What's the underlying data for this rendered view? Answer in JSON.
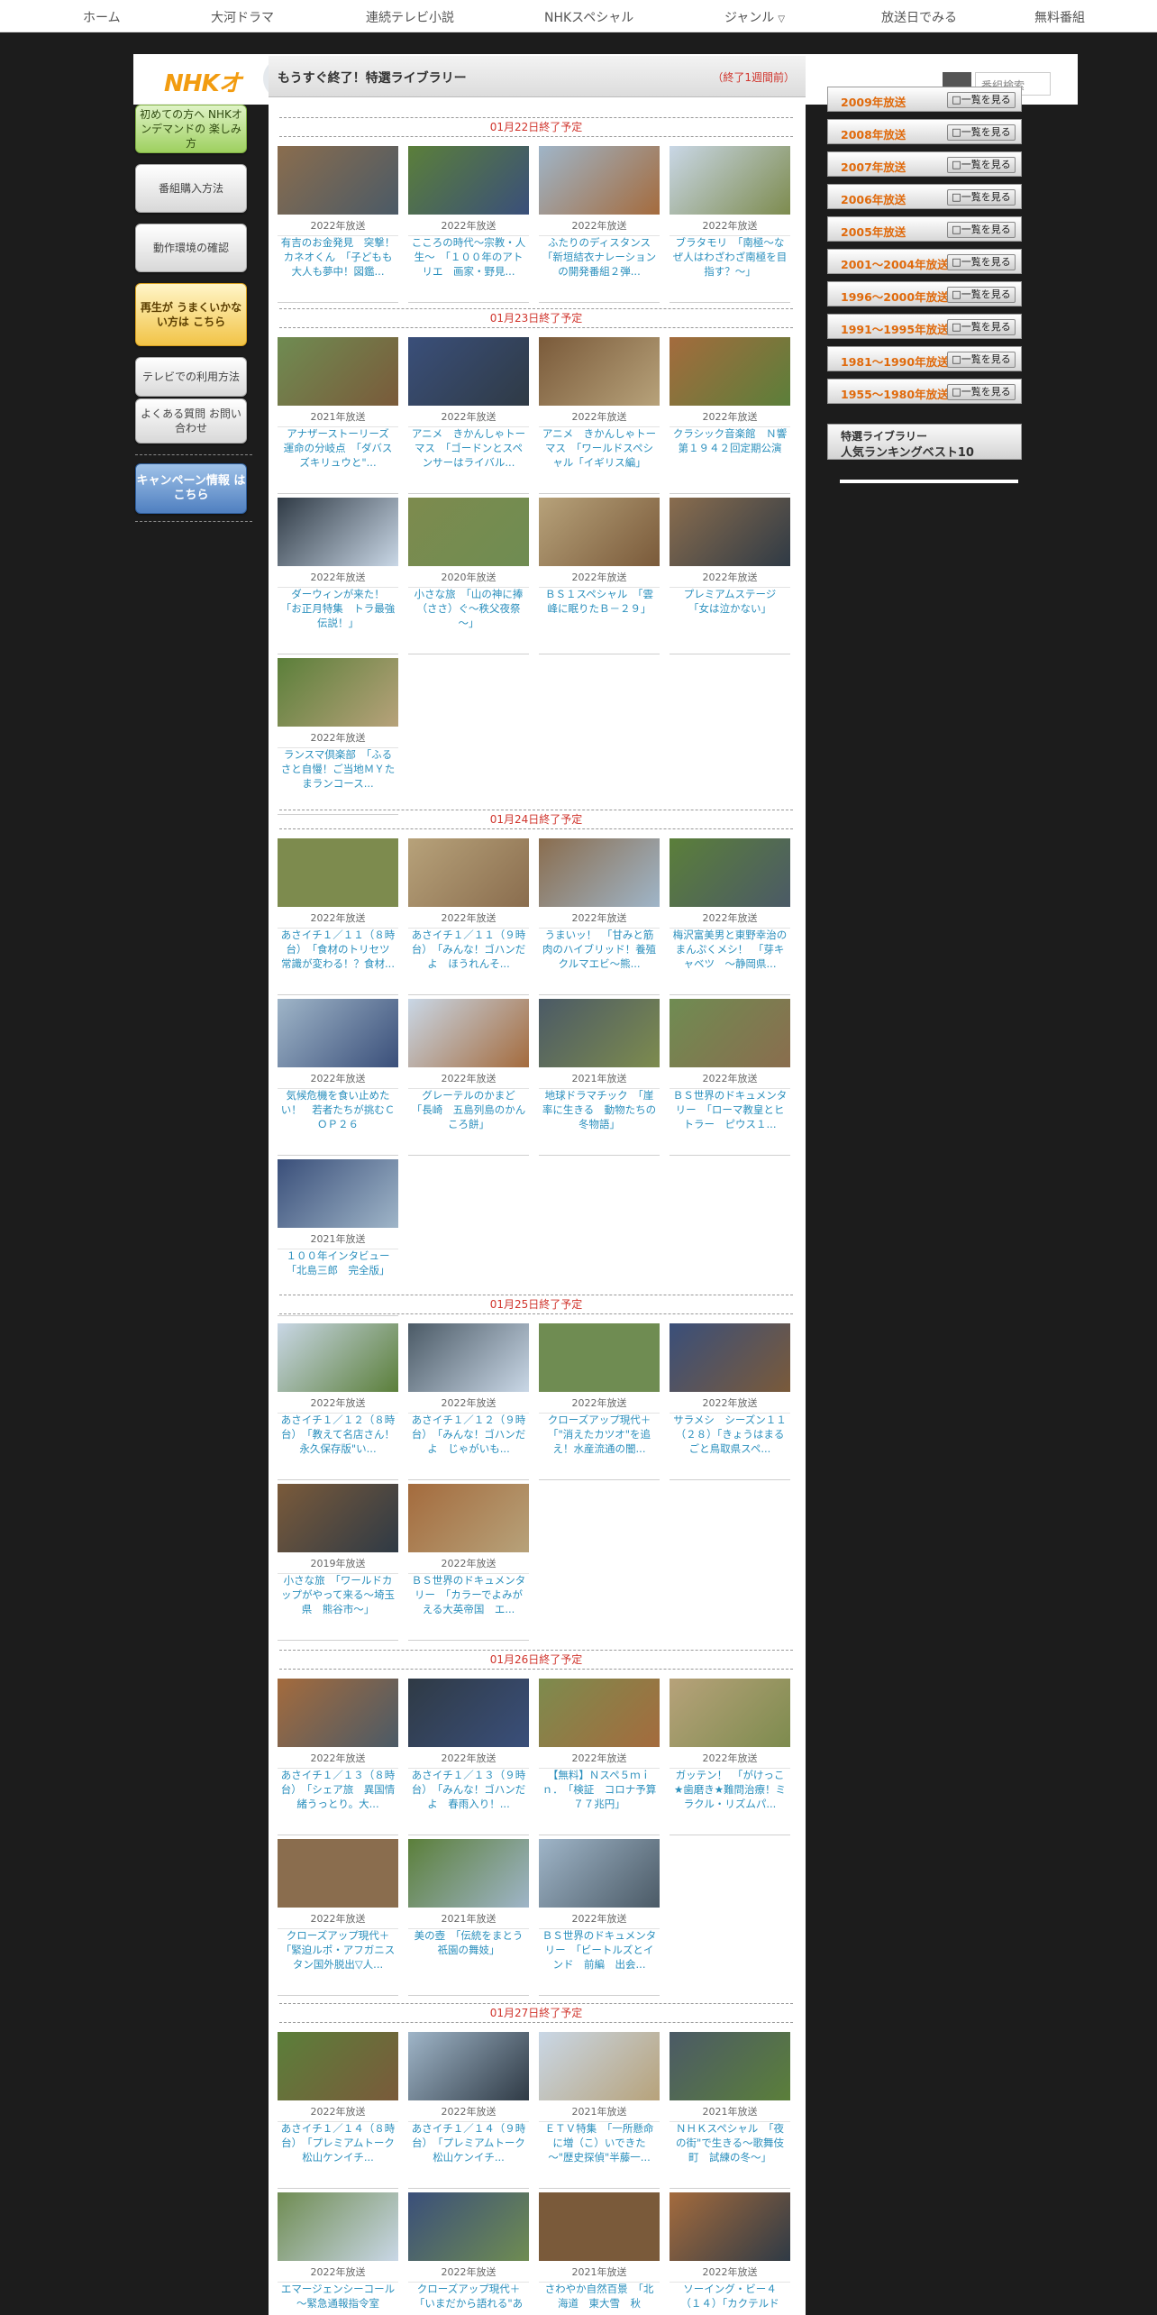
{
  "nav": [
    "ホーム",
    "大河ドラマ",
    "連続テレビ小説",
    "NHKスペシャル",
    "ジャンル",
    "放送日でみる",
    "無料番組"
  ],
  "header": {
    "logo": "NHKオ",
    "search_placeholder": "番組検索"
  },
  "main": {
    "title": "もうすぐ終了！特選ライブラリー",
    "note": "（終了1週間前）"
  },
  "left_sidebar": [
    "初めての方へ NHKオンデマンドの 楽しみ方",
    "番組購入方法",
    "動作環境の確認",
    "再生が うまくいかない方は こちら",
    "テレビでの利用方法",
    "よくある質問 お問い合わせ",
    "キャンペーン情報 はこちら"
  ],
  "sections": [
    {
      "date": "01月22日終了予定",
      "cards": [
        {
          "year": "2022年放送",
          "title": "有吉のお金発見　突撃！カネオくん　「子どもも大人も夢中！図鑑..."
        },
        {
          "year": "2022年放送",
          "title": "こころの時代～宗教・人生～　「１００年のアトリエ　画家・野見..."
        },
        {
          "year": "2022年放送",
          "title": "ふたりのディスタンス　「新垣結衣ナレーションの開発番組２弾..."
        },
        {
          "year": "2022年放送",
          "title": "ブラタモリ　「南極～なぜ人はわざわざ南極を目指す？～」"
        }
      ]
    },
    {
      "date": "01月23日終了予定",
      "cards": [
        {
          "year": "2021年放送",
          "title": "アナザーストーリーズ　運命の分岐点　「ダバスズキリュウと\"..."
        },
        {
          "year": "2022年放送",
          "title": "アニメ　きかんしゃトーマス　「ゴードンとスペンサーはライバル..."
        },
        {
          "year": "2022年放送",
          "title": "アニメ　きかんしゃトーマス　「ワールドスペシャル「イギリス編」"
        },
        {
          "year": "2022年放送",
          "title": "クラシック音楽館　Ｎ響第１９４２回定期公演"
        },
        {
          "year": "2022年放送",
          "title": "ダーウィンが来た！　「お正月特集　トラ最強伝説！」"
        },
        {
          "year": "2020年放送",
          "title": "小さな旅　「山の神に捧（ささ）ぐ～秩父夜祭～」"
        },
        {
          "year": "2022年放送",
          "title": "ＢＳ１スペシャル　「雲峰に眠りたＢ－２９」"
        },
        {
          "year": "2022年放送",
          "title": "プレミアムステージ　「女は泣かない」"
        },
        {
          "year": "2022年放送",
          "title": "ランスマ倶楽部　「ふるさと自慢！ご当地ＭＹたまランコース..."
        }
      ]
    },
    {
      "date": "01月24日終了予定",
      "cards": [
        {
          "year": "2022年放送",
          "title": "あさイチ１／１１（８時台）　「食材のトリセツ　常識が変わる！？食材..."
        },
        {
          "year": "2022年放送",
          "title": "あさイチ１／１１（９時台）　「みんな！ゴハンだよ　ほうれんそ..."
        },
        {
          "year": "2022年放送",
          "title": "うまいッ！　「甘みと筋肉のハイブリッド！養殖クルマエビ～熊..."
        },
        {
          "year": "2022年放送",
          "title": "梅沢富美男と東野幸治のまんぷくメシ！　「芽キャベツ　～静岡県..."
        },
        {
          "year": "2022年放送",
          "title": "気候危機を食い止めたい！　若者たちが挑むＣＯＰ２６"
        },
        {
          "year": "2022年放送",
          "title": "グレーテルのかまど　「長崎　五島列島のかんころ餅」"
        },
        {
          "year": "2021年放送",
          "title": "地球ドラマチック　「崖率に生きる　動物たちの冬物語」"
        },
        {
          "year": "2022年放送",
          "title": "ＢＳ世界のドキュメンタリー　「ローマ教皇とヒトラー　ピウス１..."
        },
        {
          "year": "2021年放送",
          "title": "１００年インタビュー　「北島三郎　完全版」"
        }
      ]
    },
    {
      "date": "01月25日終了予定",
      "cards": [
        {
          "year": "2022年放送",
          "title": "あさイチ１／１２（８時台）　「教えて名店さん！永久保存版\"い..."
        },
        {
          "year": "2022年放送",
          "title": "あさイチ１／１２（９時台）　「みんな！ゴハンだよ　じゃがいも..."
        },
        {
          "year": "2022年放送",
          "title": "クローズアップ現代＋　「\"消えたカツオ\"を追え！水産流通の闇..."
        },
        {
          "year": "2022年放送",
          "title": "サラメシ　シーズン１１　（２８）「きょうはまるごと鳥取県スペ..."
        },
        {
          "year": "2019年放送",
          "title": "小さな旅　「ワールドカップがやって来る～埼玉県　熊谷市～」"
        },
        {
          "year": "2022年放送",
          "title": "ＢＳ世界のドキュメンタリー　「カラーでよみがえる大英帝国　エ..."
        }
      ]
    },
    {
      "date": "01月26日終了予定",
      "cards": [
        {
          "year": "2022年放送",
          "title": "あさイチ１／１３（８時台）　「シェア旅　異国情緒うっとり。大..."
        },
        {
          "year": "2022年放送",
          "title": "あさイチ１／１３（９時台）　「みんな！ゴハンだよ　春雨入り！..."
        },
        {
          "year": "2022年放送",
          "title": "【無料】Ｎスペ５ｍｉｎ．　「検証　コロナ予算７７兆円」"
        },
        {
          "year": "2022年放送",
          "title": "ガッテン！　「がけっこ★歯磨き★難問治療！ミラクル・リズムパ..."
        },
        {
          "year": "2022年放送",
          "title": "クローズアップ現代＋　「緊迫ルポ・アフガニスタン国外脱出▽人..."
        },
        {
          "year": "2021年放送",
          "title": "美の壺　「伝統をまとう　祇園の舞妓」"
        },
        {
          "year": "2022年放送",
          "title": "ＢＳ世界のドキュメンタリー　「ビートルズとインド　前編　出会..."
        }
      ]
    },
    {
      "date": "01月27日終了予定",
      "cards": [
        {
          "year": "2022年放送",
          "title": "あさイチ１／１４（８時台）　「プレミアムトーク　松山ケンイチ..."
        },
        {
          "year": "2022年放送",
          "title": "あさイチ１／１４（９時台）　「プレミアムトーク　松山ケンイチ..."
        },
        {
          "year": "2021年放送",
          "title": "ＥＴＶ特集　「一所懸命に増（こ）いできた～\"歴史探偵\"半藤一..."
        },
        {
          "year": "2021年放送",
          "title": "ＮＨＫスペシャル　「夜の街\"で生きる～歌舞伎町　試練の冬～」"
        },
        {
          "year": "2022年放送",
          "title": "エマージェンシーコール　～緊急通報指令室"
        },
        {
          "year": "2022年放送",
          "title": "クローズアップ現代＋　「いまだから語れる\"あ"
        },
        {
          "year": "2021年放送",
          "title": "さわやか自然百景　「北海道　東大雪　秋"
        },
        {
          "year": "2022年放送",
          "title": "ソーイング・ビー４　（１４）「カクテルド"
        }
      ]
    }
  ],
  "year_buttons": [
    {
      "label": "2009年放送",
      "link": "□一覧を見る"
    },
    {
      "label": "2008年放送",
      "link": "□一覧を見る"
    },
    {
      "label": "2007年放送",
      "link": "□一覧を見る"
    },
    {
      "label": "2006年放送",
      "link": "□一覧を見る"
    },
    {
      "label": "2005年放送",
      "link": "□一覧を見る"
    },
    {
      "label": "2001～2004年放送",
      "link": "□一覧を見る"
    },
    {
      "label": "1996～2000年放送",
      "link": "□一覧を見る"
    },
    {
      "label": "1991～1995年放送",
      "link": "□一覧を見る"
    },
    {
      "label": "1981～1990年放送",
      "link": "□一覧を見る"
    },
    {
      "label": "1955～1980年放送",
      "link": "□一覧を見る"
    }
  ],
  "ranking": {
    "line1": "特選ライブラリー",
    "line2": "人気ランキングベスト10"
  },
  "colors": {
    "accent": "#d0342c",
    "link": "#2a8fbd",
    "year_label": "#e06a0c"
  }
}
